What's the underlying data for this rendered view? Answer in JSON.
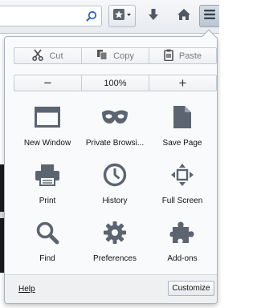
{
  "toolbar": {
    "search_icon": "search-icon",
    "bookmark_icon": "bookmark-star-icon",
    "downloads_icon": "download-arrow-icon",
    "home_icon": "home-icon",
    "menu_icon": "hamburger-menu-icon"
  },
  "panel": {
    "edit": {
      "cut": "Cut",
      "copy": "Copy",
      "paste": "Paste"
    },
    "zoom": {
      "minus": "−",
      "level": "100%",
      "plus": "+"
    },
    "items": [
      {
        "label": "New Window",
        "icon": "new-window-icon"
      },
      {
        "label": "Private Browsi...",
        "icon": "private-mask-icon"
      },
      {
        "label": "Save Page",
        "icon": "save-page-icon"
      },
      {
        "label": "Print",
        "icon": "printer-icon"
      },
      {
        "label": "History",
        "icon": "clock-icon"
      },
      {
        "label": "Full Screen",
        "icon": "fullscreen-icon"
      },
      {
        "label": "Find",
        "icon": "magnifier-icon"
      },
      {
        "label": "Preferences",
        "icon": "gear-icon"
      },
      {
        "label": "Add-ons",
        "icon": "puzzle-icon"
      }
    ],
    "footer": {
      "help": "Help",
      "customize": "Customize"
    }
  },
  "colors": {
    "icon_gray": "#5b6470",
    "panel_bg": "#f9fafb",
    "toolbar_bg": "#eceff2"
  }
}
